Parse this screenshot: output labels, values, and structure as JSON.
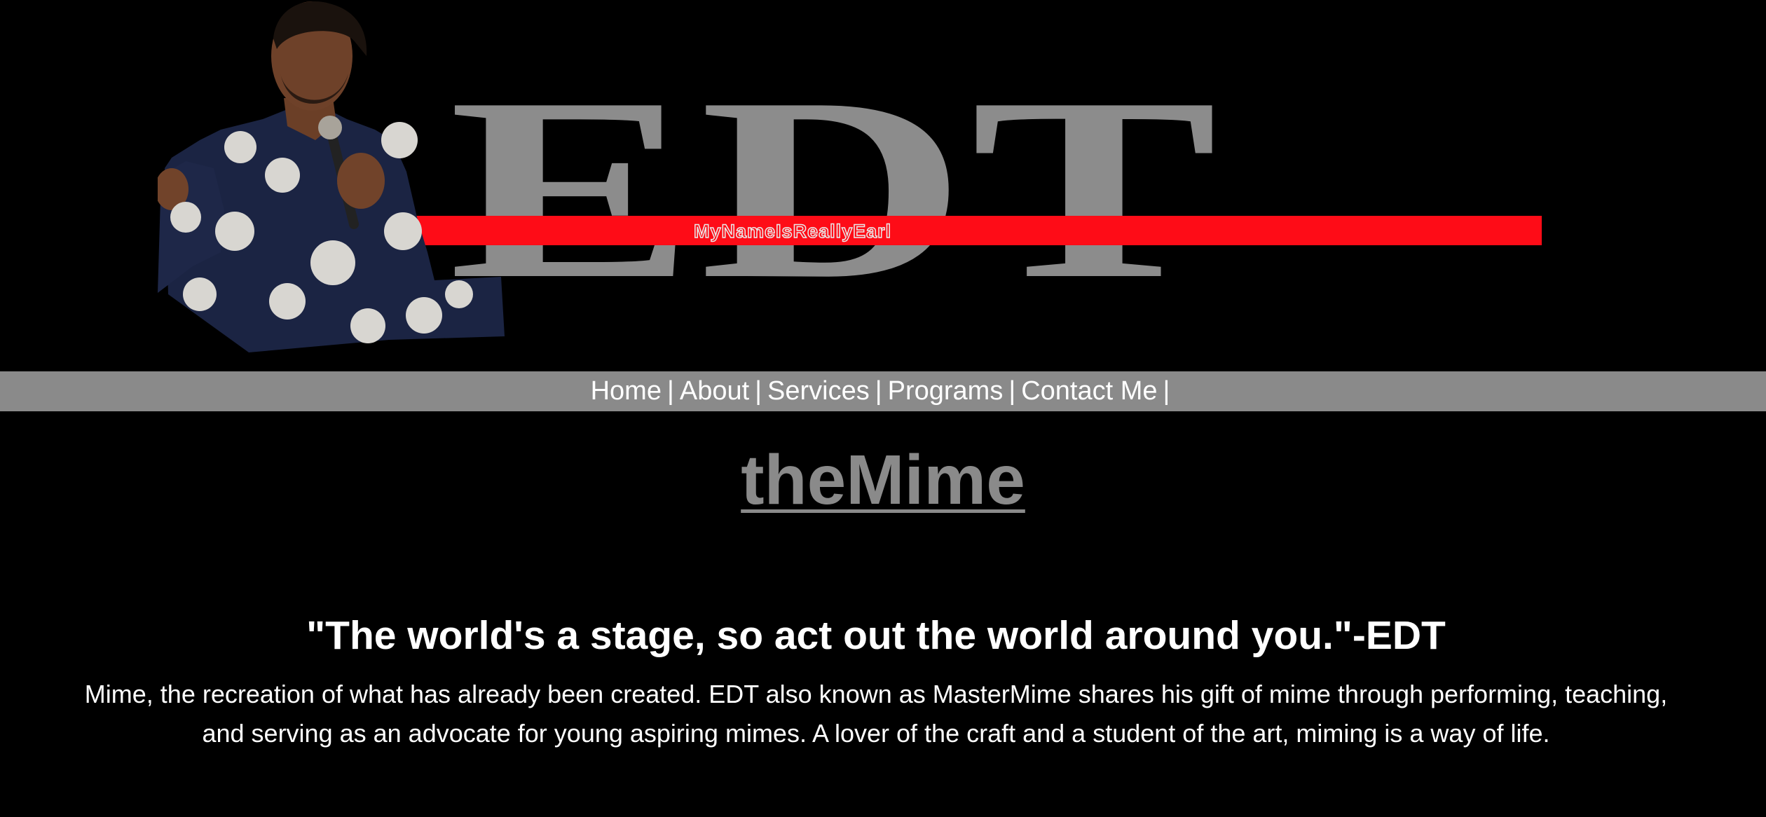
{
  "logo": {
    "letters": "EDT",
    "tagline": "MyNameIsReallyEarl"
  },
  "nav": {
    "items": [
      {
        "label": "Home"
      },
      {
        "label": "About"
      },
      {
        "label": "Services"
      },
      {
        "label": "Programs"
      },
      {
        "label": "Contact Me"
      }
    ],
    "separator": "|"
  },
  "main": {
    "title": "theMime",
    "quote": "\"The world's a stage, so act out the world around you.\"-EDT",
    "about_line1": "Mime, the recreation of what has already been created. EDT also known as MasterMime shares his gift of mime through performing, teaching,",
    "about_line2": "and serving as an advocate for young aspiring mimes. A lover of the craft and a student of the art, miming is a way of life."
  },
  "colors": {
    "background": "#000000",
    "logo_gray": "#8c8c8c",
    "band_red": "#fe0c17",
    "nav_bar": "#8a8a8a",
    "text": "#ffffff"
  }
}
